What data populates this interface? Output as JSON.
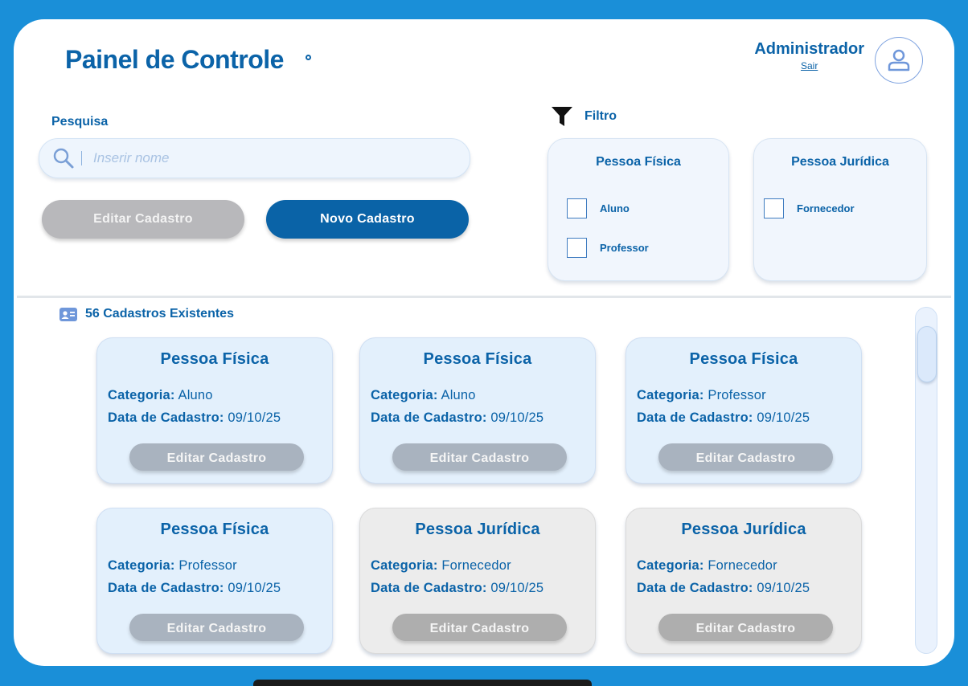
{
  "header": {
    "title": "Painel de Controle",
    "user_name": "Administrador",
    "logout_label": "Sair",
    "avatar_icon": "user-icon"
  },
  "search": {
    "label": "Pesquisa",
    "placeholder": "Inserir nome",
    "value": "",
    "icon": "search-icon"
  },
  "actions": {
    "edit_label": "Editar Cadastro",
    "new_label": "Novo Cadastro"
  },
  "filter": {
    "label": "Filtro",
    "icon": "filter-icon",
    "groups": [
      {
        "title": "Pessoa Física",
        "options": [
          {
            "label": "Aluno",
            "checked": false
          },
          {
            "label": "Professor",
            "checked": false
          }
        ]
      },
      {
        "title": "Pessoa Jurídica",
        "options": [
          {
            "label": "Fornecedor",
            "checked": false
          }
        ]
      }
    ]
  },
  "records": {
    "count_label": "56 Cadastros Existentes",
    "icon": "id-card-icon",
    "category_label": "Categoria:",
    "date_label": "Data de Cadastro:",
    "button_label": "Editar Cadastro",
    "items": [
      {
        "type": "Pessoa Física",
        "category": "Aluno",
        "date": "09/10/25"
      },
      {
        "type": "Pessoa Física",
        "category": "Aluno",
        "date": "09/10/25"
      },
      {
        "type": "Pessoa Física",
        "category": "Professor",
        "date": "09/10/25"
      },
      {
        "type": "Pessoa Física",
        "category": "Professor",
        "date": "09/10/25"
      },
      {
        "type": "Pessoa Jurídica",
        "category": "Fornecedor",
        "date": "09/10/25"
      },
      {
        "type": "Pessoa Jurídica",
        "category": "Fornecedor",
        "date": "09/10/25"
      }
    ]
  },
  "colors": {
    "background": "#1a8fd8",
    "primary": "#0b63a8",
    "pf_card": "#e3f0fc",
    "pj_card": "#ececec",
    "disabled_button": "#b8b8bb"
  }
}
